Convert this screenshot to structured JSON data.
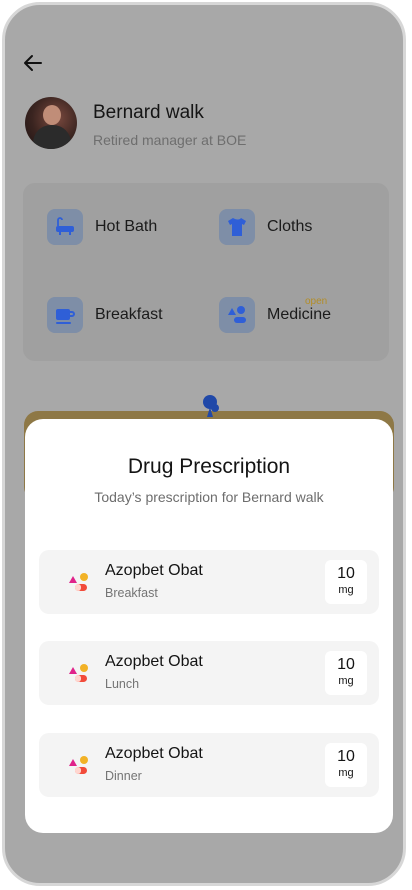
{
  "profile": {
    "name": "Bernard walk",
    "subtitle": "Retired manager at BOE"
  },
  "services": [
    {
      "label": "Hot Bath",
      "icon": "bathtub-icon"
    },
    {
      "label": "Cloths",
      "icon": "shirt-icon"
    },
    {
      "label": "Breakfast",
      "icon": "coffee-cup-icon"
    },
    {
      "label": "Medicine",
      "icon": "pills-icon",
      "tag": "open"
    }
  ],
  "sheet": {
    "title": "Drug Prescription",
    "subtitle": "Today’s prescription for Bernard walk",
    "items": [
      {
        "name": "Azopbet Obat",
        "meal": "Breakfast",
        "dose": "10",
        "unit": "mg"
      },
      {
        "name": "Azopbet Obat",
        "meal": "Lunch",
        "dose": "10",
        "unit": "mg"
      },
      {
        "name": "Azopbet Obat",
        "meal": "Dinner",
        "dose": "10",
        "unit": "mg"
      }
    ]
  },
  "colors": {
    "overlay": "#a8a8a8",
    "sheet": "#ffffff",
    "accent_blue": "#2f5fd7",
    "accent_yellow": "#e7b62d"
  }
}
